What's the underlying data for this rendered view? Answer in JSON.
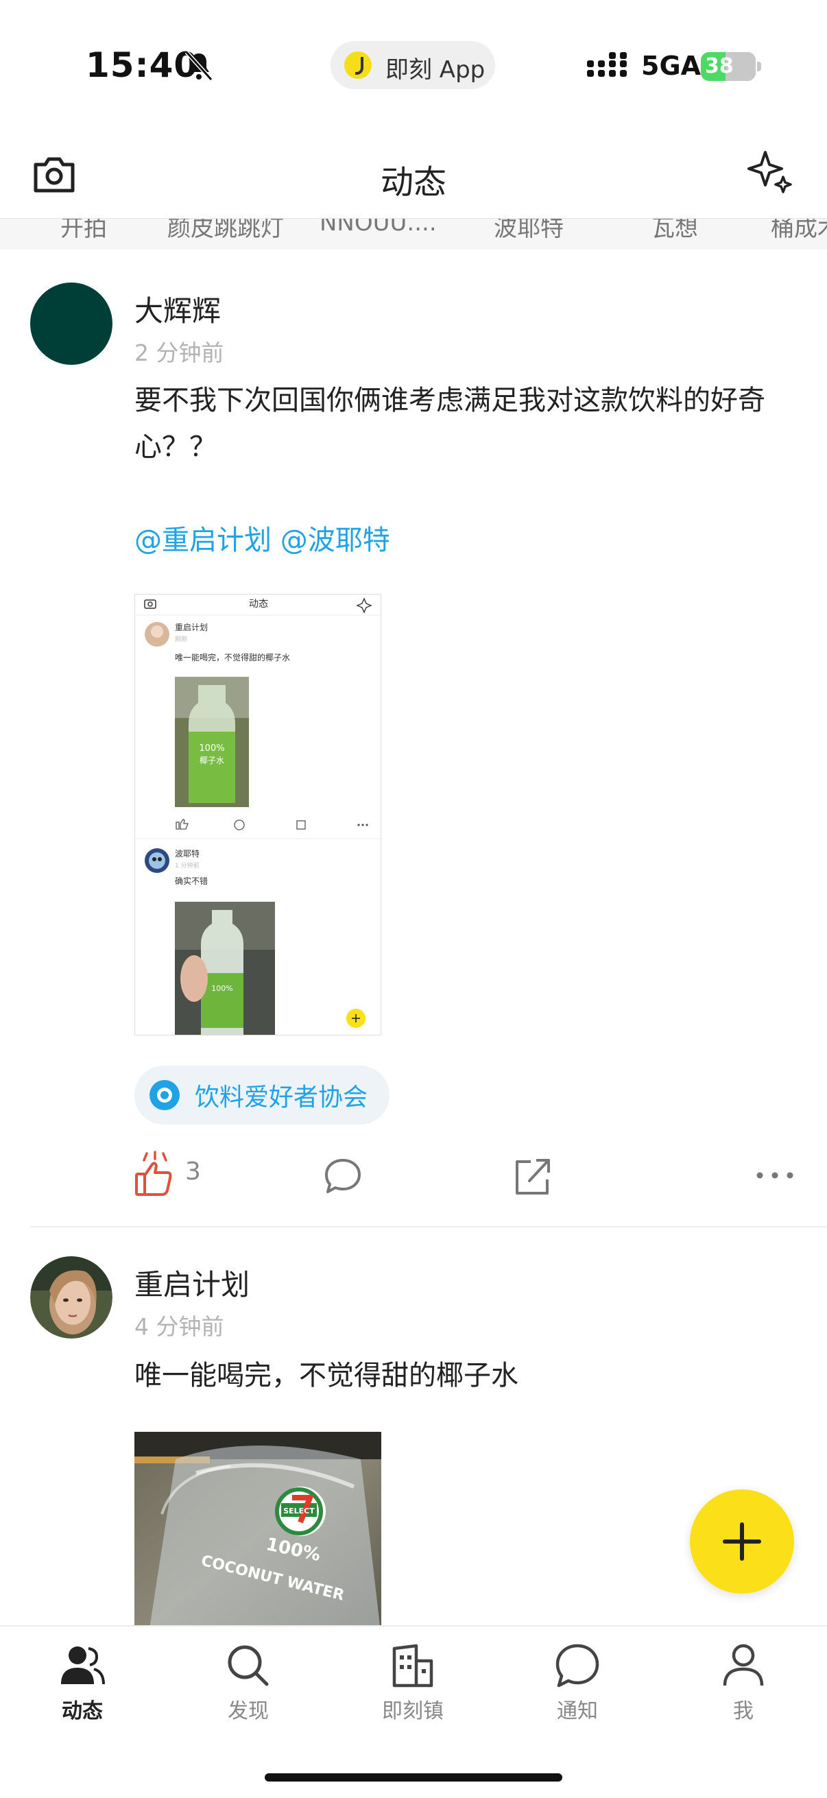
{
  "status_bar": {
    "time": "15:40",
    "app_pill": "即刻 App",
    "network": "5GA",
    "battery": "38"
  },
  "header": {
    "title": "动态",
    "left_icon": "camera-icon",
    "right_icon": "sparkle-icon"
  },
  "strip": {
    "names": [
      "开拍",
      "颜皮跳跳灯",
      "NNOUU....",
      "波耶特",
      "瓦想",
      "桶成木"
    ]
  },
  "posts": [
    {
      "author": "大辉辉",
      "time": "2 分钟前",
      "text": "要不我下次回国你俩谁考虑满足我对这款饮料的好奇心？？",
      "mention1": "@重启计划",
      "mention2": "@波耶特",
      "topic": "饮料爱好者协会",
      "likes": "3",
      "avatar_color": "#003f38",
      "screenshot": {
        "title": "动态",
        "entry1_author": "重启计划",
        "entry1_time": "刚刚",
        "entry1_text": "唯一能喝完，不觉得甜的椰子水",
        "entry2_author": "波耶特",
        "entry2_time": "1 分钟前",
        "entry2_text": "确实不错",
        "bottle_label1": "100%",
        "bottle_label2": "椰子水"
      }
    },
    {
      "author": "重启计划",
      "time": "4 分钟前",
      "text": "唯一能喝完，不觉得甜的椰子水",
      "image_label1": "100%",
      "image_label2": "COCONUT WATER",
      "image_brand": "SELECT"
    }
  ],
  "tabs": [
    {
      "label": "动态",
      "icon": "people-icon",
      "active": true
    },
    {
      "label": "发现",
      "icon": "search-icon",
      "active": false
    },
    {
      "label": "即刻镇",
      "icon": "building-icon",
      "active": false
    },
    {
      "label": "通知",
      "icon": "chat-bubble-icon",
      "active": false
    },
    {
      "label": "我",
      "icon": "person-icon",
      "active": false
    }
  ],
  "colors": {
    "accent_yellow": "#fbe019",
    "link_blue": "#1fa3e6",
    "like_red": "#e0503a"
  }
}
